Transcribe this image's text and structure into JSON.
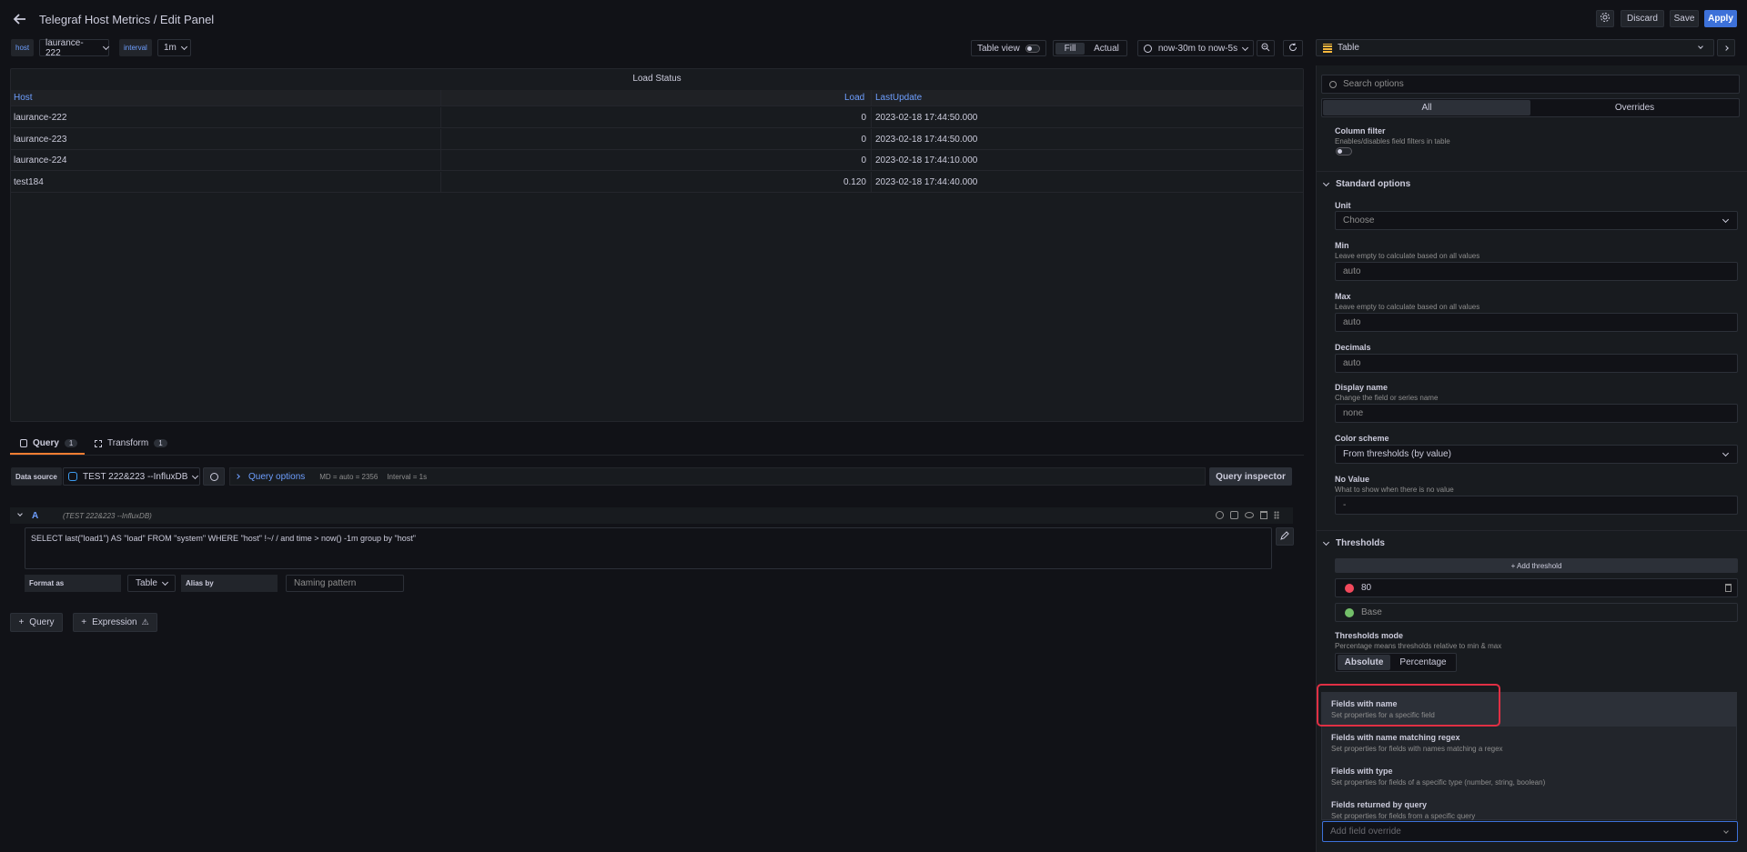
{
  "header": {
    "title": "Telegraf Host Metrics / Edit Panel",
    "discard_label": "Discard",
    "save_label": "Save",
    "apply_label": "Apply"
  },
  "variables": {
    "host_label": "host",
    "host_value": "laurance-222",
    "interval_label": "interval",
    "interval_value": "1m"
  },
  "toolbar": {
    "table_view_label": "Table view",
    "fill_label": "Fill",
    "actual_label": "Actual",
    "time_range": "now-30m to now-5s"
  },
  "visualization": {
    "selected": "Table"
  },
  "panel": {
    "title": "Load Status",
    "columns": [
      "Host",
      "Load",
      "LastUpdate"
    ],
    "rows": [
      {
        "host": "laurance-222",
        "load": "0",
        "last": "2023-02-18 17:44:50.000"
      },
      {
        "host": "laurance-223",
        "load": "0",
        "last": "2023-02-18 17:44:50.000"
      },
      {
        "host": "laurance-224",
        "load": "0",
        "last": "2023-02-18 17:44:10.000"
      },
      {
        "host": "test184",
        "load": "0.120",
        "last": "2023-02-18 17:44:40.000"
      }
    ]
  },
  "query_tabs": {
    "query_label": "Query",
    "query_count": "1",
    "transform_label": "Transform",
    "transform_count": "1"
  },
  "datasource": {
    "label": "Data source",
    "value": "TEST 222&223 --InfluxDB",
    "query_options_label": "Query options",
    "md_text": "MD = auto = 2356",
    "interval_text": "Interval = 1s",
    "inspector_label": "Query inspector"
  },
  "query": {
    "ref": "A",
    "ds_hint": "(TEST 222&223 --InfluxDB)",
    "text": "SELECT last(\"load1\") AS \"load\" FROM \"system\" WHERE  \"host\" !~/        / and time > now() -1m group by \"host\"",
    "format_as_label": "Format as",
    "format_value": "Table",
    "alias_label": "Alias by",
    "alias_placeholder": "Naming pattern",
    "add_query_label": "Query",
    "add_expression_label": "Expression"
  },
  "options": {
    "search_placeholder": "Search options",
    "tab_all": "All",
    "tab_overrides": "Overrides",
    "column_filter_title": "Column filter",
    "column_filter_desc": "Enables/disables field filters in table",
    "standard_options": "Standard options",
    "unit_label": "Unit",
    "unit_placeholder": "Choose",
    "min_label": "Min",
    "min_desc": "Leave empty to calculate based on all values",
    "min_value": "auto",
    "max_label": "Max",
    "max_desc": "Leave empty to calculate based on all values",
    "max_value": "auto",
    "decimals_label": "Decimals",
    "decimals_value": "auto",
    "display_name_label": "Display name",
    "display_name_desc": "Change the field or series name",
    "display_name_value": "none",
    "color_scheme_label": "Color scheme",
    "color_scheme_value": "From thresholds (by value)",
    "no_value_label": "No Value",
    "no_value_desc": "What to show when there is no value",
    "no_value_value": "-",
    "thresholds": "Thresholds",
    "add_threshold": "+ Add threshold",
    "threshold_1": "80",
    "threshold_base": "Base",
    "thresholds_mode_label": "Thresholds mode",
    "thresholds_mode_desc": "Percentage means thresholds relative to min & max",
    "mode_absolute": "Absolute",
    "mode_percentage": "Percentage"
  },
  "override_menu": {
    "items": [
      {
        "title": "Fields with name",
        "desc": "Set properties for a specific field"
      },
      {
        "title": "Fields with name matching regex",
        "desc": "Set properties for fields with names matching a regex"
      },
      {
        "title": "Fields with type",
        "desc": "Set properties for fields of a specific type (number, string, boolean)"
      },
      {
        "title": "Fields returned by query",
        "desc": "Set properties for fields from a specific query"
      }
    ],
    "input_placeholder": "Add field override"
  },
  "colors": {
    "accent": "#3d71d9",
    "threshold_red": "#f2495c",
    "threshold_green": "#73bf69",
    "highlight": "#e02f44",
    "orange": "#f87d32"
  }
}
